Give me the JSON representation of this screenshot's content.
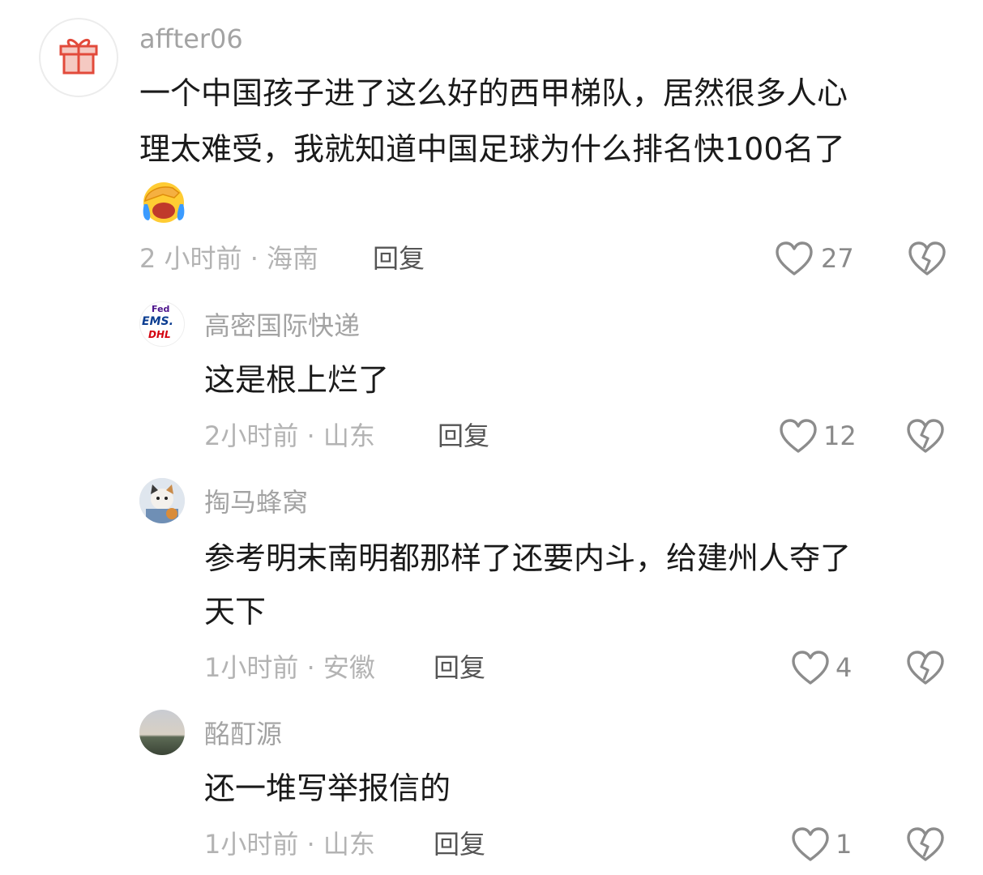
{
  "comments": [
    {
      "username": "affter06",
      "text_lines": [
        "一个中国孩子进了这么好的西甲梯队，居然很多人心",
        "理太难受，我就知道中国足球为什么排名快100名了"
      ],
      "emoji": "facepalm-crying-emoji",
      "time": "2 小时前 · 海南",
      "reply_label": "回复",
      "likes": "27",
      "avatar_icon": "gift-icon"
    },
    {
      "username": "高密国际快递",
      "text_lines": [
        "这是根上烂了"
      ],
      "time": "2小时前 · 山东",
      "reply_label": "回复",
      "likes": "12",
      "avatar_badge": {
        "line1": "Fed",
        "line2": "EMS.",
        "line3": "DHL"
      }
    },
    {
      "username": "掏马蜂窝",
      "text_lines": [
        "参考明末南明都那样了还要内斗，给建州人夺了",
        "天下"
      ],
      "time": "1小时前 · 安徽",
      "reply_label": "回复",
      "likes": "4"
    },
    {
      "username": "酩酊源",
      "text_lines": [
        "还一堆写举报信的"
      ],
      "time": "1小时前 · 山东",
      "reply_label": "回复",
      "likes": "1"
    }
  ],
  "colors": {
    "heart": "#8c8c8c",
    "username": "#a3a3a3",
    "text": "#1a1a1a",
    "meta": "#b3b3b3"
  }
}
